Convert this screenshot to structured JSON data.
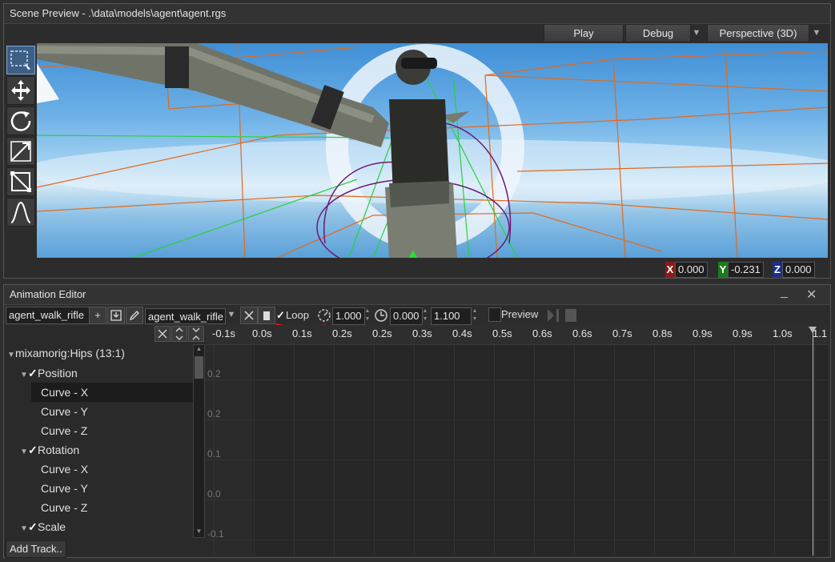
{
  "scene": {
    "title": "Scene Preview - .\\data\\models\\agent\\agent.rgs",
    "play_label": "Play",
    "debug_label": "Debug",
    "view_mode": "Perspective (3D)",
    "tools": [
      "select-icon",
      "move-icon",
      "rotate-icon",
      "scale-icon",
      "bounds-icon",
      "curve-icon"
    ],
    "coords": {
      "x_tag": "X",
      "x": "0.000",
      "y_tag": "Y",
      "y": "-0.231",
      "z_tag": "Z",
      "z": "0.000"
    },
    "colors": {
      "x": "#8a1c1c",
      "y": "#1d7a1d",
      "z": "#1d2f8a"
    }
  },
  "anim": {
    "title": "Animation Editor",
    "minimize": "_",
    "close": "✕",
    "clip_name": "agent_walk_rifle",
    "clip_name2": "agent_walk_rifle",
    "add_glyph": "+",
    "loop_label": "Loop",
    "loop_checked": true,
    "speed": "1.000",
    "time": "0.000",
    "length": "1.100",
    "preview_label": "Preview",
    "add_track_label": "Add Track..",
    "tracks": [
      {
        "label": "mixamorig:Hips (13:1)"
      },
      {
        "label": "Position"
      },
      {
        "label": "Curve - X"
      },
      {
        "label": "Curve - Y"
      },
      {
        "label": "Curve - Z"
      },
      {
        "label": "Rotation"
      },
      {
        "label": "Curve - X"
      },
      {
        "label": "Curve - Y"
      },
      {
        "label": "Curve - Z"
      },
      {
        "label": "Scale"
      }
    ],
    "timeline_ticks": [
      "-0.1s",
      "0.0s",
      "0.1s",
      "0.2s",
      "0.2s",
      "0.3s",
      "0.4s",
      "0.5s",
      "0.6s",
      "0.6s",
      "0.7s",
      "0.8s",
      "0.9s",
      "0.9s",
      "1.0s",
      "1.1"
    ],
    "y_labels": [
      "0.2",
      "0.2",
      "0.1",
      "0.0",
      "-0.1"
    ]
  }
}
